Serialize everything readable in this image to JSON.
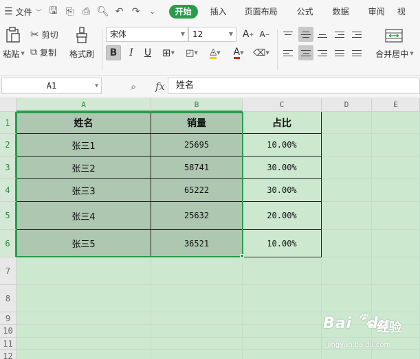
{
  "menubar": {
    "file_label": "文件",
    "tabs": [
      "开始",
      "插入",
      "页面布局",
      "公式",
      "数据",
      "审阅",
      "视"
    ]
  },
  "ribbon": {
    "paste_label": "粘贴",
    "cut_label": "剪切",
    "copy_label": "复制",
    "format_painter_label": "格式刷",
    "font_name": "宋体",
    "font_size": "12",
    "bold_label": "B",
    "italic_label": "I",
    "underline_label": "U",
    "merge_label": "合并居中"
  },
  "formula_bar": {
    "cell_ref": "A1",
    "fx_label": "fx",
    "content": "姓名"
  },
  "sheet": {
    "columns": [
      "A",
      "B",
      "C",
      "D",
      "E"
    ],
    "rows": [
      "1",
      "2",
      "3",
      "4",
      "5",
      "6",
      "7",
      "8",
      "9",
      "10",
      "11",
      "12"
    ],
    "header": [
      "姓名",
      "销量",
      "占比"
    ],
    "data": [
      [
        "张三1",
        "25695",
        "10.00%"
      ],
      [
        "张三2",
        "58741",
        "30.00%"
      ],
      [
        "张三3",
        "65222",
        "30.00%"
      ],
      [
        "张三4",
        "25632",
        "20.00%"
      ],
      [
        "张三5",
        "36521",
        "10.00%"
      ]
    ]
  },
  "watermark": {
    "brand": "Bai",
    "brand2": "du",
    "cn": "经验",
    "url": "jingyan.baidu.com"
  },
  "colors": {
    "accent": "#2b9b4c",
    "sheet_bg": "#cce8cf",
    "selection_fill": "#adc7b0"
  }
}
